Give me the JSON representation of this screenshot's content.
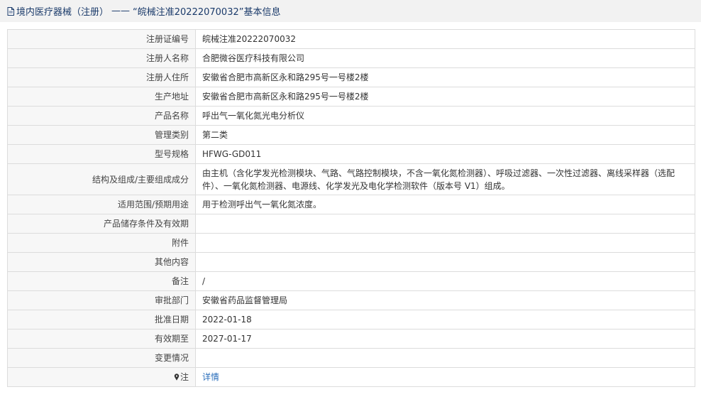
{
  "header": {
    "category": "境内医疗器械（注册）",
    "separator": "——",
    "record_title": "“皖械注准20222070032”基本信息"
  },
  "rows": [
    {
      "label": "注册证编号",
      "value": "皖械注准20222070032"
    },
    {
      "label": "注册人名称",
      "value": "合肥微谷医疗科技有限公司"
    },
    {
      "label": "注册人住所",
      "value": "安徽省合肥市高新区永和路295号一号楼2楼"
    },
    {
      "label": "生产地址",
      "value": "安徽省合肥市高新区永和路295号一号楼2楼"
    },
    {
      "label": "产品名称",
      "value": "呼出气一氧化氮光电分析仪"
    },
    {
      "label": "管理类别",
      "value": "第二类"
    },
    {
      "label": "型号规格",
      "value": "HFWG-GD011"
    },
    {
      "label": "结构及组成/主要组成成分",
      "value": "由主机（含化学发光检测模块、气路、气路控制模块，不含一氧化氮检测器）、呼吸过滤器、一次性过滤器、离线采样器（选配件）、一氧化氮检测器、电源线、化学发光及电化学检测软件（版本号 V1）组成。"
    },
    {
      "label": "适用范围/预期用途",
      "value": "用于检测呼出气一氧化氮浓度。"
    },
    {
      "label": "产品储存条件及有效期",
      "value": ""
    },
    {
      "label": "附件",
      "value": ""
    },
    {
      "label": "其他内容",
      "value": ""
    },
    {
      "label": "备注",
      "value": "/"
    },
    {
      "label": "审批部门",
      "value": "安徽省药品监督管理局"
    },
    {
      "label": "批准日期",
      "value": "2022-01-18"
    },
    {
      "label": "有效期至",
      "value": "2027-01-17"
    },
    {
      "label": "变更情况",
      "value": ""
    }
  ],
  "note_row": {
    "label": "注",
    "icon": "pin-icon",
    "link_text": "详情"
  },
  "colors": {
    "header_bg": "#f2f2f2",
    "label_bg": "#f7f7f7",
    "border": "#dcdcdc",
    "link": "#2a6ebb"
  }
}
